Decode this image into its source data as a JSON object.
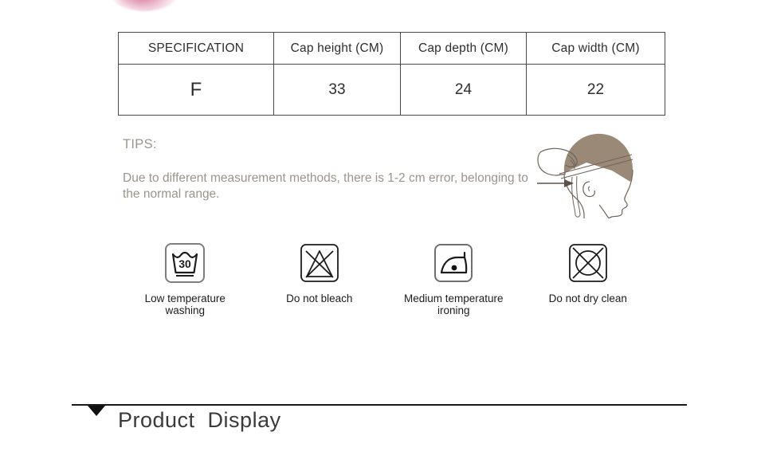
{
  "decor": {
    "pompom_name": "pink-pompom-fragment"
  },
  "spec_table": {
    "headers": [
      "SPECIFICATION",
      "Cap height (CM)",
      "Cap depth (CM)",
      "Cap width (CM)"
    ],
    "rows": [
      [
        "F",
        "33",
        "24",
        "22"
      ]
    ]
  },
  "tips": {
    "title": "TIPS:",
    "body": "Due to different measurement methods, there is 1-2 cm error, belonging to the normal range.",
    "text_color": "#9c948a"
  },
  "illustration": {
    "name": "head-measurement-diagram",
    "cap_color": "#9b8977",
    "outline_color": "#6f645a",
    "arrow_color": "#5e5248"
  },
  "care_symbols": [
    {
      "icon": "wash-tub-30-icon",
      "label": "Low temperature\nwashing",
      "value": "30"
    },
    {
      "icon": "do-not-bleach-icon",
      "label": "Do not bleach"
    },
    {
      "icon": "iron-one-dot-icon",
      "label": "Medium temperature\nironing"
    },
    {
      "icon": "do-not-dry-clean-icon",
      "label": "Do not dry clean"
    }
  ],
  "section": {
    "title": "Product  Display",
    "marker": "down-triangle-icon",
    "rule_color": "#1a1a1a"
  }
}
